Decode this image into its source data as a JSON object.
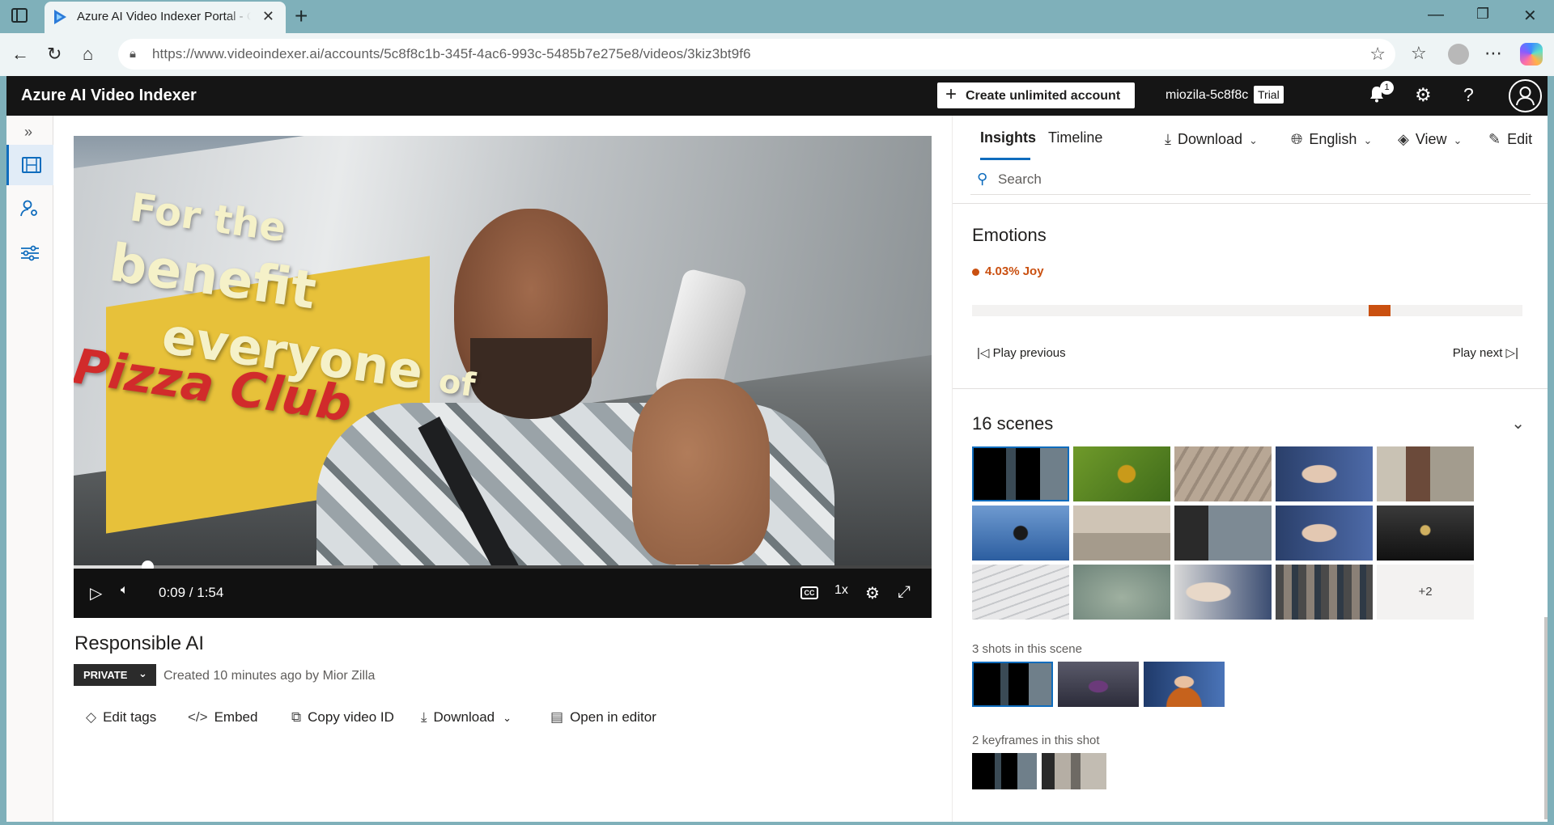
{
  "browser": {
    "tab_title": "Azure AI Video Indexer Portal - Co",
    "url": "https://www.videoindexer.ai/accounts/5c8f8c1b-345f-4ac6-993c-5485b7e275e8/videos/3kiz3bt9f6"
  },
  "app": {
    "brand": "Azure AI Video Indexer",
    "create_button": "Create unlimited account",
    "account_name": "miozila-5c8f8c",
    "trial_badge": "Trial",
    "notification_count": "1"
  },
  "video": {
    "overlay_line1": "For the",
    "overlay_line2": "benefit",
    "overlay_line3": "of",
    "overlay_line4": "everyone",
    "overlay_sign": "Pizza Club",
    "time": "0:09 / 1:54",
    "speed": "1x",
    "progress_fraction": 0.0857,
    "title": "Responsible AI",
    "privacy": "PRIVATE",
    "created": "Created 10 minutes ago by Mior Zilla"
  },
  "actions": {
    "edit_tags": "Edit tags",
    "embed": "Embed",
    "copy_id": "Copy video ID",
    "download": "Download",
    "open_editor": "Open in editor"
  },
  "panel": {
    "tabs": [
      "Insights",
      "Timeline"
    ],
    "download": "Download",
    "language": "English",
    "view": "View",
    "edit": "Edit",
    "search_placeholder": "Search",
    "emotions_title": "Emotions",
    "emotion_value": "4.03% Joy",
    "emotion_segment_start": 0.72,
    "emotion_segment_end": 0.76,
    "play_previous": "Play previous",
    "play_next": "Play next",
    "scenes_title": "16 scenes",
    "more_scenes": "+2",
    "shots_label": "3 shots in this scene",
    "keyframes_label": "2 keyframes in this shot"
  }
}
